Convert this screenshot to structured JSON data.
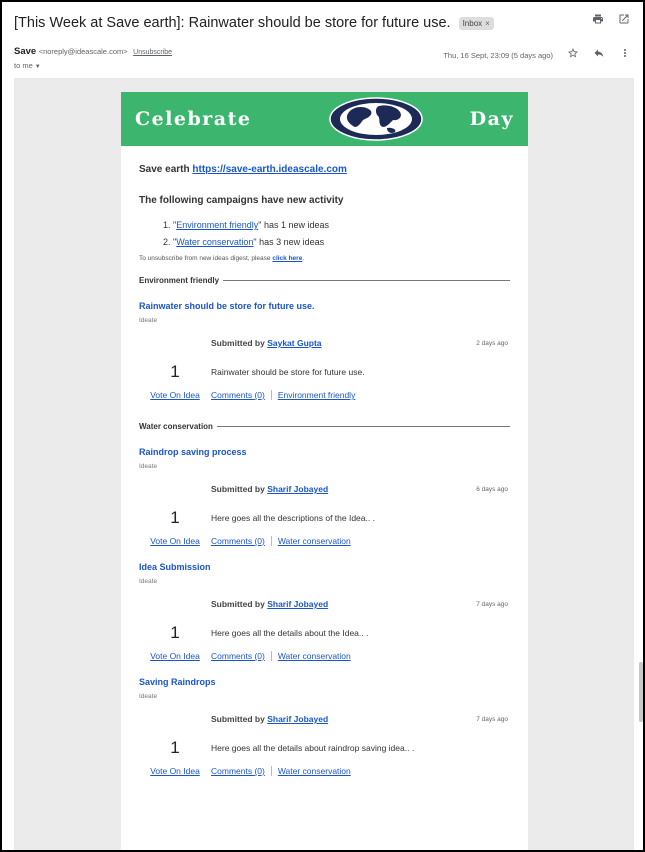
{
  "email": {
    "subject": "[This Week at Save earth]: Rainwater should be store for future use.",
    "label": "Inbox",
    "label_close": "×",
    "sender_name": "Save",
    "sender_email": "<noreply@ideascale.com>",
    "unsubscribe": "Unsubscribe",
    "to": "to me",
    "date": "Thu, 16 Sept, 23:09 (5 days ago)"
  },
  "banner": {
    "left_word": "Celebrate",
    "right_word": "Day",
    "color": "#3cb66f"
  },
  "digest": {
    "site_name": "Save earth",
    "site_url": "https://save-earth.ideascale.com",
    "activity_title": "The following campaigns have new activity",
    "campaigns": [
      {
        "num": "1.",
        "name": "Environment friendly",
        "suffix": " has 1 new ideas"
      },
      {
        "num": "2.",
        "name": "Water conservation",
        "suffix": " has 3 new ideas"
      }
    ],
    "unsub_text": "To unsubscribe from new ideas digest, please ",
    "unsub_link": "click here",
    "unsub_end": "."
  },
  "sections": [
    {
      "heading": "Environment friendly",
      "ideas": [
        {
          "title": "Rainwater should be store for future use.",
          "type": "Ideate",
          "submitted_label": "Submitted by ",
          "author": "Saykat Gupta",
          "ago": "2 days ago",
          "votes": "1",
          "desc": "Rainwater should be store for future use.",
          "vote_link": "Vote On Idea",
          "comments": "Comments (0)",
          "campaign": "Environment friendly"
        }
      ]
    },
    {
      "heading": "Water conservation",
      "ideas": [
        {
          "title": "Raindrop saving process",
          "type": "Ideate",
          "submitted_label": "Submitted by ",
          "author": "Sharif Jobayed",
          "ago": "6 days ago",
          "votes": "1",
          "desc": "Here goes all the descriptions of the Idea.. .",
          "vote_link": "Vote On Idea",
          "comments": "Comments (0)",
          "campaign": "Water conservation"
        },
        {
          "title": "Idea Submission",
          "type": "Ideate",
          "submitted_label": "Submitted by ",
          "author": "Sharif Jobayed",
          "ago": "7 days ago",
          "votes": "1",
          "desc": "Here goes all the details about the Idea.. .",
          "vote_link": "Vote On Idea",
          "comments": "Comments (0)",
          "campaign": "Water conservation"
        },
        {
          "title": "Saving Raindrops",
          "type": "Ideate",
          "submitted_label": "Submitted by ",
          "author": "Sharif Jobayed",
          "ago": "7 days ago",
          "votes": "1",
          "desc": "Here goes all the details about raindrop saving idea.. .",
          "vote_link": "Vote On Idea",
          "comments": "Comments (0)",
          "campaign": "Water conservation"
        }
      ]
    }
  ],
  "icons": {
    "print": "print-icon",
    "open_new": "open-in-new-window-icon",
    "star": "star-icon",
    "reply": "reply-icon",
    "more": "more-vertical-icon",
    "globe": "globe-icon"
  }
}
